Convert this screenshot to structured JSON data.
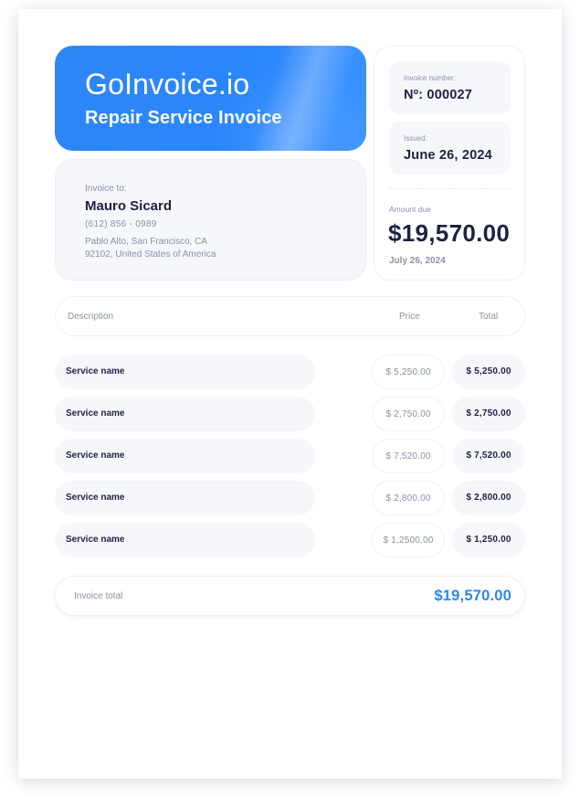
{
  "brand": {
    "name": "GoInvoice.io",
    "subtitle": "Repair Service Invoice",
    "accent_color": "#2b86f6"
  },
  "client": {
    "label": "Invoice to:",
    "name": "Mauro Sicard",
    "phone": "(612) 856 - 0989",
    "address_line1": "Pablo Alto, San Francisco, CA",
    "address_line2": "92102, United States of America"
  },
  "meta": {
    "invoice_number_label": "Invoice number:",
    "invoice_number": "Nº: 000027",
    "issued_label": "Issued:",
    "issued_date": "June 26, 2024",
    "amount_due_label": "Amount due",
    "amount_due": "$19,570.00",
    "due_date": "July 26, 2024"
  },
  "table": {
    "headers": {
      "description": "Description",
      "price": "Price",
      "total": "Total"
    },
    "rows": [
      {
        "description": "Service name",
        "price": "$ 5,250.00",
        "total": "$ 5,250.00"
      },
      {
        "description": "Service name",
        "price": "$ 2,750.00",
        "total": "$ 2,750.00"
      },
      {
        "description": "Service name",
        "price": "$ 7,520.00",
        "total": "$ 7,520.00"
      },
      {
        "description": "Service name",
        "price": "$ 2,800.00",
        "total": "$ 2,800.00"
      },
      {
        "description": "Service name",
        "price": "$ 1,2500.00",
        "total": "$ 1,250.00"
      }
    ]
  },
  "summary": {
    "label": "Invoice total",
    "amount": "$19,570.00"
  }
}
